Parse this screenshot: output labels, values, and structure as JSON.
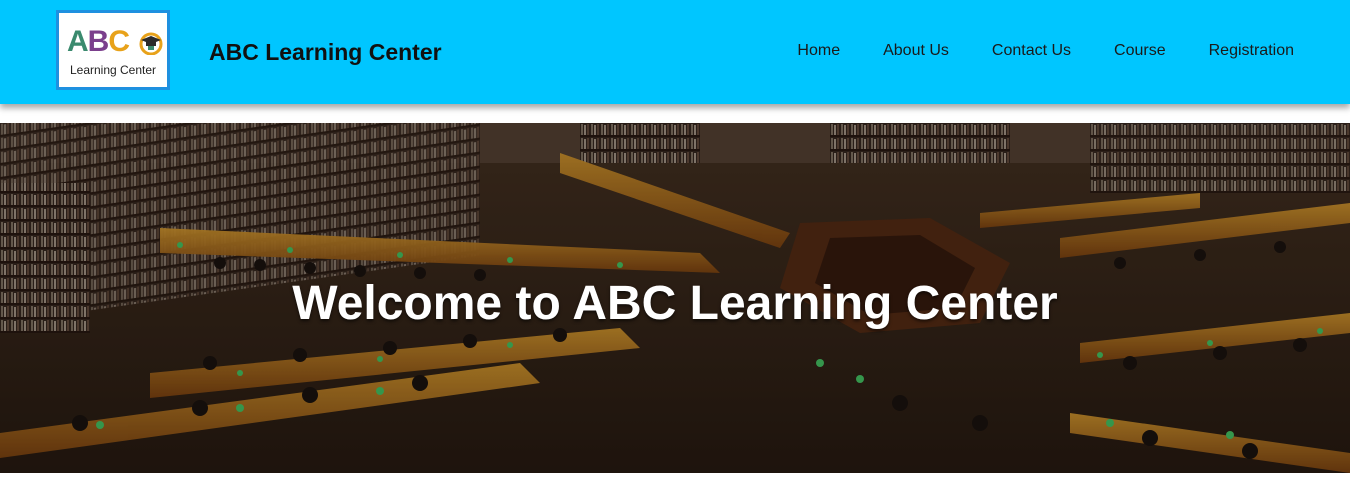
{
  "header": {
    "logo": {
      "letters": [
        "A",
        "B",
        "C"
      ],
      "subtitle": "Learning Center",
      "colors": {
        "a": "#3a8a6e",
        "b": "#7b3f8c",
        "c": "#e8a21a",
        "border": "#1e90e0"
      }
    },
    "title": "ABC Learning Center",
    "background_color": "#00c6ff",
    "nav": [
      {
        "label": "Home"
      },
      {
        "label": "About Us"
      },
      {
        "label": "Contact Us"
      },
      {
        "label": "Course"
      },
      {
        "label": "Registration"
      }
    ]
  },
  "hero": {
    "heading": "Welcome to ABC Learning Center",
    "image_subject": "library reading room with students at desks"
  }
}
